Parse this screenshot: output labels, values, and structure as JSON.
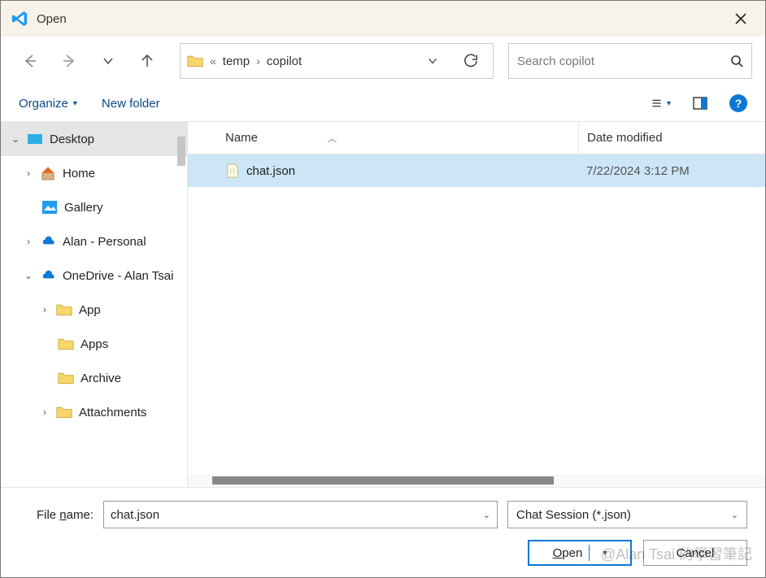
{
  "title": "Open",
  "breadcrumbs": {
    "sep0": "«",
    "seg1": "temp",
    "sep1": "›",
    "seg2": "copilot"
  },
  "search": {
    "placeholder": "Search copilot"
  },
  "commands": {
    "organize": "Organize",
    "new_folder": "New folder"
  },
  "columns": {
    "name": "Name",
    "date": "Date modified"
  },
  "sidebar": {
    "desktop": "Desktop",
    "home": "Home",
    "gallery": "Gallery",
    "alan_personal": "Alan - Personal",
    "onedrive": "OneDrive - Alan Tsai",
    "app": "App",
    "apps": "Apps",
    "archive": "Archive",
    "attachments": "Attachments"
  },
  "files": [
    {
      "name": "chat.json",
      "date": "7/22/2024 3:12 PM"
    }
  ],
  "filename": {
    "label_pre": "File ",
    "label_ul": "n",
    "label_post": "ame:",
    "value": "chat.json"
  },
  "filetype": {
    "value": "Chat Session (*.json)"
  },
  "buttons": {
    "open_ul": "O",
    "open_rest": "pen",
    "cancel": "Cancel"
  },
  "watermark": "@Alan Tsai 的學習筆記"
}
